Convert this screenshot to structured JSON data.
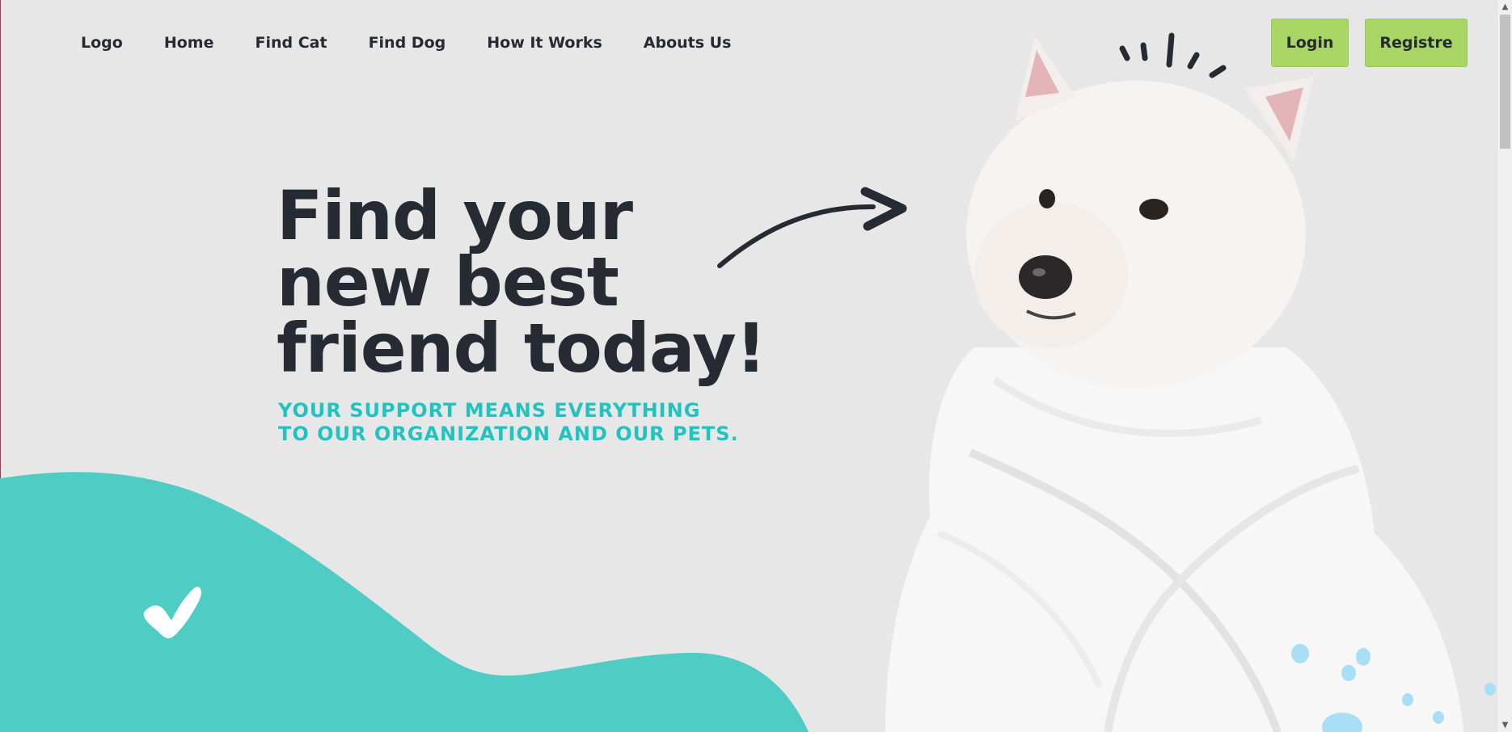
{
  "nav": {
    "items": [
      "Logo",
      "Home",
      "Find Cat",
      "Find Dog",
      "How It Works",
      "Abouts Us"
    ]
  },
  "auth": {
    "login_label": "Login",
    "register_label": "Registre"
  },
  "hero": {
    "headline_lines": [
      "Find your",
      "new best",
      "friend today!"
    ],
    "subtitle_lines": [
      "YOUR SUPPORT MEANS EVERYTHING",
      "TO OUR ORGANIZATION AND OUR PETS."
    ]
  },
  "colors": {
    "background": "#e8e7e8",
    "accent_teal": "#4fcdc4",
    "button_green": "#a9d564",
    "text_dark": "#262b33",
    "subtitle_teal": "#21c3c0"
  },
  "icons": [
    "checkmark-icon",
    "arrow-icon",
    "sparkle-lines-icon",
    "paw-dots-icon",
    "scroll-up-icon",
    "scroll-down-icon"
  ]
}
